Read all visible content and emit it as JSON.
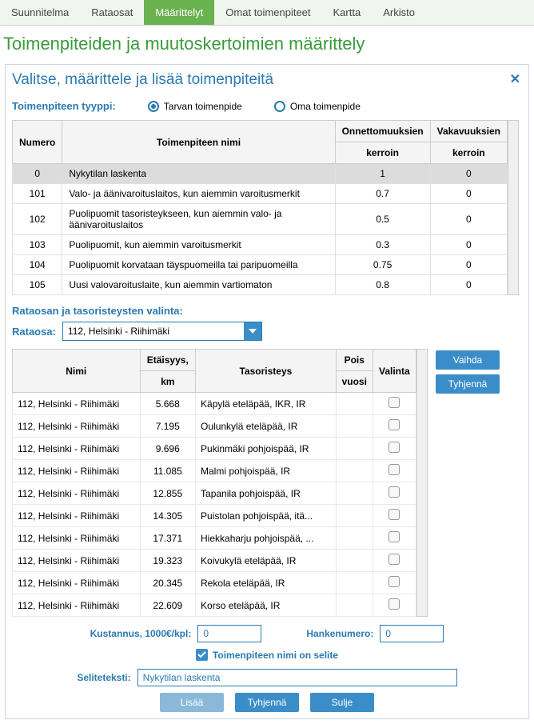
{
  "tabs": [
    "Suunnitelma",
    "Rataosat",
    "Määrittelyt",
    "Omat toimenpiteet",
    "Kartta",
    "Arkisto"
  ],
  "active_tab": 2,
  "page_title": "Toimenpiteiden ja muutoskertoimien määrittely",
  "dialog": {
    "title": "Valitse, määrittele ja lisää toimenpiteitä",
    "type_label": "Toimenpiteen tyyppi:",
    "radio1": "Tarvan toimenpide",
    "radio2": "Oma toimenpide",
    "table1": {
      "headers": {
        "numero": "Numero",
        "nimi": "Toimenpiteen nimi",
        "onn": "Onnettomuuksien",
        "vak": "Vakavuuksien",
        "ker": "kerroin"
      },
      "rows": [
        {
          "num": "0",
          "nimi": "Nykytilan laskenta",
          "onn": "1",
          "vak": "0"
        },
        {
          "num": "101",
          "nimi": "Valo- ja äänivaroituslaitos, kun aiemmin varoitusmerkit",
          "onn": "0.7",
          "vak": "0"
        },
        {
          "num": "102",
          "nimi": "Puolipuomit tasoristeykseen, kun aiemmin valo- ja äänivaroituslaitos",
          "onn": "0.5",
          "vak": "0"
        },
        {
          "num": "103",
          "nimi": "Puolipuomit, kun aiemmin varoitusmerkit",
          "onn": "0.3",
          "vak": "0"
        },
        {
          "num": "104",
          "nimi": "Puolipuomit korvataan täyspuomeilla tai paripuomeilla",
          "onn": "0.75",
          "vak": "0"
        },
        {
          "num": "105",
          "nimi": "Uusi valovaroituslaite, kun aiemmin vartiomaton",
          "onn": "0.8",
          "vak": "0"
        }
      ]
    },
    "section_label": "Rataosan ja tasoristeysten valinta:",
    "combo_label": "Rataosa:",
    "combo_value": "112, Helsinki - Riihimäki",
    "table2": {
      "headers": {
        "nimi": "Nimi",
        "et": "Etäisyys,",
        "km": "km",
        "taso": "Tasoristeys",
        "pois": "Pois",
        "vuosi": "vuosi",
        "val": "Valinta"
      },
      "rows": [
        {
          "nimi": "112, Helsinki - Riihimäki",
          "km": "5.668",
          "taso": "Käpylä eteläpää, IKR, IR"
        },
        {
          "nimi": "112, Helsinki - Riihimäki",
          "km": "7.195",
          "taso": "Oulunkylä eteläpää, IR"
        },
        {
          "nimi": "112, Helsinki - Riihimäki",
          "km": "9.696",
          "taso": "Pukinmäki pohjoispää, IR"
        },
        {
          "nimi": "112, Helsinki - Riihimäki",
          "km": "11.085",
          "taso": "Malmi pohjoispää, IR"
        },
        {
          "nimi": "112, Helsinki - Riihimäki",
          "km": "12.855",
          "taso": "Tapanila pohjoispää, IR"
        },
        {
          "nimi": "112, Helsinki - Riihimäki",
          "km": "14.305",
          "taso": "Puistolan pohjoispää, itä..."
        },
        {
          "nimi": "112, Helsinki - Riihimäki",
          "km": "17.371",
          "taso": "Hiekkaharju pohjoispää, ..."
        },
        {
          "nimi": "112, Helsinki - Riihimäki",
          "km": "19.323",
          "taso": "Koivukylä eteläpää, IR"
        },
        {
          "nimi": "112, Helsinki - Riihimäki",
          "km": "20.345",
          "taso": "Rekola eteläpää, IR"
        },
        {
          "nimi": "112, Helsinki - Riihimäki",
          "km": "22.609",
          "taso": "Korso eteläpää, IR"
        }
      ]
    },
    "side_buttons": {
      "vaihda": "Vaihda",
      "tyhjenna": "Tyhjennä"
    },
    "form": {
      "kust_label": "Kustannus, 1000€/kpl:",
      "kust_value": "0",
      "hanke_label": "Hankenumero:",
      "hanke_value": "0",
      "check_label": "Toimenpiteen nimi on selite",
      "selite_label": "Seliteteksti:",
      "selite_value": "Nykytilan laskenta"
    },
    "bottom_buttons": {
      "lisaa": "Lisää",
      "tyhjenna": "Tyhjennä",
      "sulje": "Sulje"
    }
  }
}
